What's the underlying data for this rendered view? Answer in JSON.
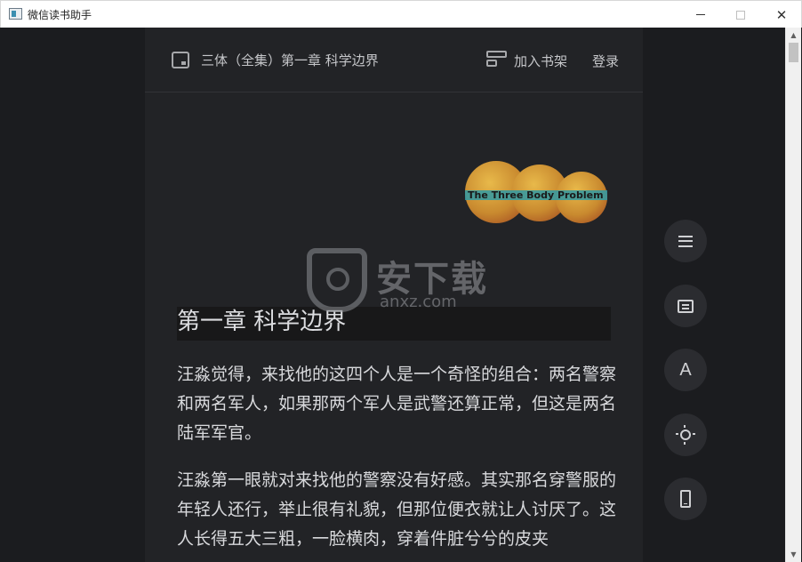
{
  "window": {
    "title": "微信读书助手",
    "minimize_glyph": "",
    "close_glyph": "✕"
  },
  "topbar": {
    "book_title": "三体（全集）第一章 科学边界",
    "add_to_shelf": "加入书架",
    "login": "登录"
  },
  "cover": {
    "text": "The Three Body Problem"
  },
  "watermark": {
    "cn": "安下载",
    "en": "anxz.com"
  },
  "chapter": {
    "title": "第一章 科学边界",
    "paragraphs": [
      "汪淼觉得，来找他的这四个人是一个奇怪的组合：两名警察和两名军人，如果那两个军人是武警还算正常，但这是两名陆军军官。",
      "汪淼第一眼就对来找他的警察没有好感。其实那名穿警服的年轻人还行，举止很有礼貌，但那位便衣就让人讨厌了。这人长得五大三粗，一脸横肉，穿着件脏兮兮的皮夹"
    ]
  },
  "side_buttons": {
    "font_label": "A",
    "icons": [
      "menu-icon",
      "comment-icon",
      "font-icon",
      "brightness-icon",
      "phone-icon"
    ]
  },
  "scrollbar": {
    "up": "▲",
    "down": "▼"
  },
  "colors": {
    "background": "#1b1c1f",
    "page": "#222326",
    "text": "#d8d9dc"
  }
}
